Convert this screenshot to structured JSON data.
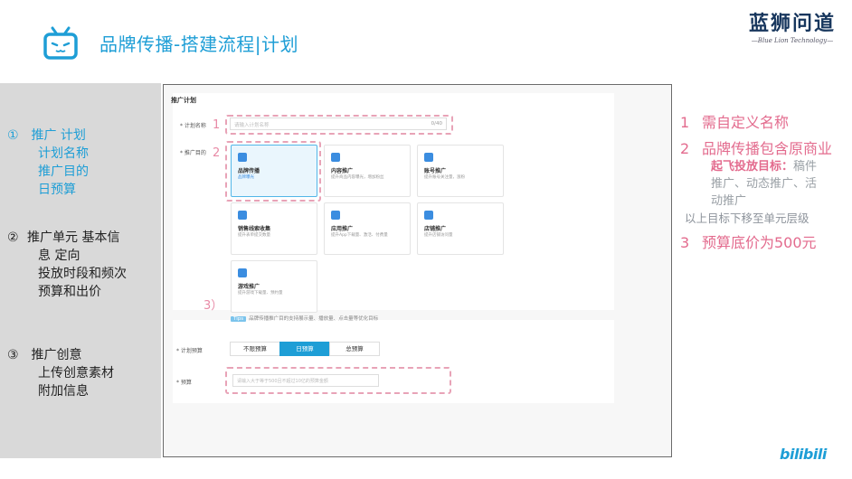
{
  "header": {
    "title": "品牌传播-搭建流程|计划"
  },
  "brand": {
    "name": "蓝狮问道",
    "subtitle": "—Blue Lion Technology—"
  },
  "left_steps": {
    "step1": {
      "marker": "①",
      "lines": [
        "推广 计划",
        "计划名称",
        "推广目的",
        "日预算"
      ]
    },
    "step2": {
      "marker": "②",
      "lines": [
        "推广单元  基本信",
        "息  定向",
        "投放时段和频次",
        "预算和出价"
      ]
    },
    "step3": {
      "marker": "③",
      "lines": [
        "推广创意",
        "上传创意素材",
        "附加信息"
      ]
    }
  },
  "screenshot": {
    "section_title": "推广计划",
    "plan_name_label": "* 计划名称",
    "plan_name_placeholder": "请输入计划名称",
    "plan_name_counter": "0/40",
    "purpose_label": "* 推广目的",
    "cards": [
      {
        "name": "品牌传播",
        "desc": "品牌曝光",
        "selected": true
      },
      {
        "name": "内容推广",
        "desc": "提升商品内容曝光，增加粉丝",
        "selected": false
      },
      {
        "name": "账号推广",
        "desc": "提升账号关注量，涨粉",
        "selected": false
      },
      {
        "name": "销售线索收集",
        "desc": "提升表单提交数量",
        "selected": false
      },
      {
        "name": "应用推广",
        "desc": "提升App下载量、激活、付费量",
        "selected": false
      },
      {
        "name": "店铺推广",
        "desc": "提升店铺访问量",
        "selected": false
      },
      {
        "name": "游戏推广",
        "desc": "提升游戏下载量、预约量",
        "selected": false
      }
    ],
    "tips_tag": "Tips",
    "tips_text": "品牌传播推广目的支持展示量、播放量、点击量等优化目标",
    "budget_label": "* 计划预算",
    "budget_tabs": [
      "不限预算",
      "日预算",
      "总预算"
    ],
    "budget_active": 1,
    "budget_field_label": "* 预算",
    "budget_placeholder": "请输入大于等于500且不超过10亿的预算金额"
  },
  "markers": [
    "1",
    "2",
    "3）"
  ],
  "notes": {
    "n1_num": "1",
    "n1_text": "需自定义名称",
    "n2_num": "2",
    "n2_text": "品牌传播包含原商业",
    "n2_sub_red": "起飞投放目标：",
    "n2_sub_grey1": "稿件",
    "n2_sub_grey2": "推广、动态推广、活",
    "n2_sub_grey3": "动推广",
    "n2_move": "以上目标下移至单元层级",
    "n3_num": "3",
    "n3_text": "预算底价为500元"
  },
  "footer_logo": "bilibili",
  "colors": {
    "accent_blue": "#1e9ed6",
    "note_pink": "#e36b8e",
    "dash_pink": "#e8a3b7",
    "panel_grey": "#d9d9d9"
  }
}
